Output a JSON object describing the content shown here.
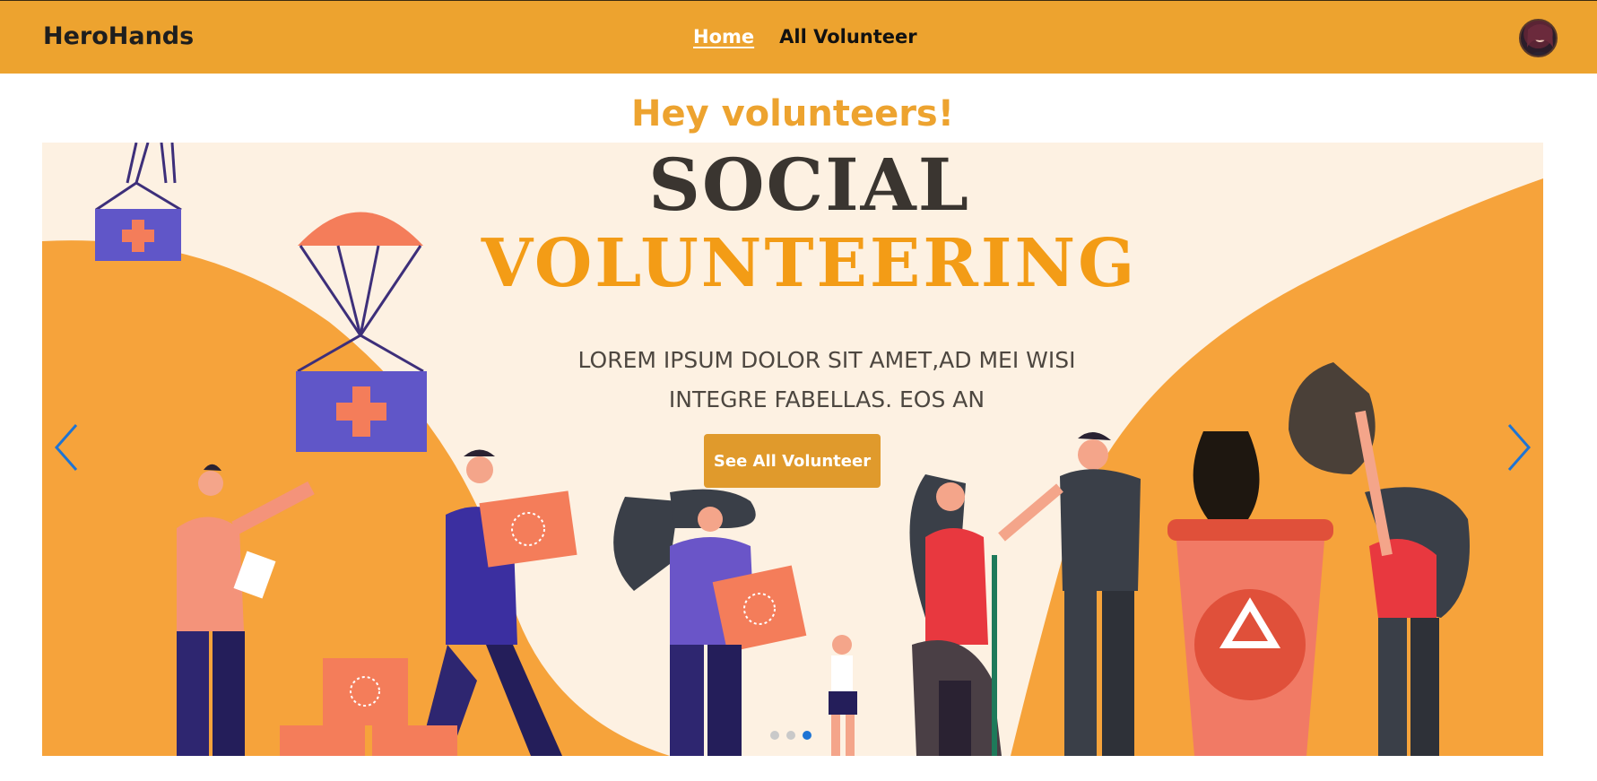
{
  "navbar": {
    "brand": "HeroHands",
    "links": [
      {
        "label": "Home",
        "active": true
      },
      {
        "label": "All Volunteer",
        "active": false
      }
    ],
    "accent_color": "#eda32f",
    "avatar_icon": "user-avatar"
  },
  "hero": {
    "heading": "Hey volunteers!"
  },
  "carousel": {
    "slide": {
      "title_line1": "SOCIAL",
      "title_line2": "VOLUNTEERING",
      "text_line1": "LOREM IPSUM DOLOR SIT AMET,AD MEI WISI",
      "text_line2": "INTEGRE FABELLAS. EOS AN",
      "cta_label": "See All Volunteer"
    },
    "prev_icon": "chevron-left-icon",
    "next_icon": "chevron-right-icon",
    "indicator_count": 3,
    "active_indicator": 3,
    "arrow_color": "#1e74d4"
  }
}
